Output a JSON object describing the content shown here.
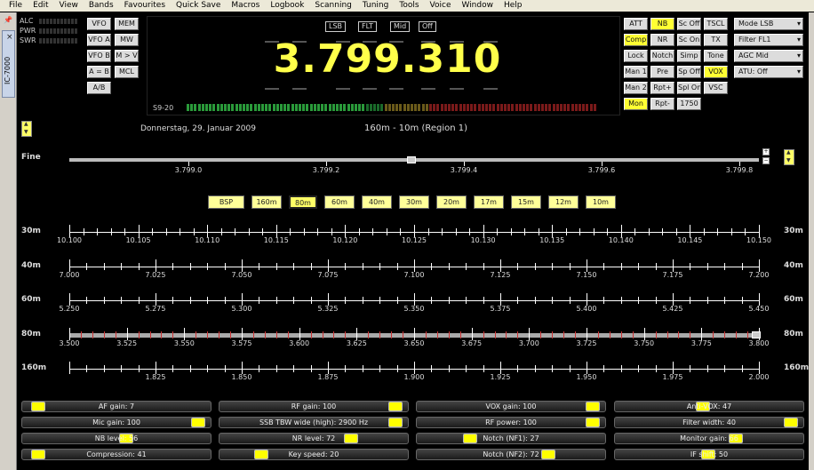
{
  "menu": [
    "File",
    "Edit",
    "View",
    "Bands",
    "Favourites",
    "Quick Save",
    "Macros",
    "Logbook",
    "Scanning",
    "Tuning",
    "Tools",
    "Voice",
    "Window",
    "Help"
  ],
  "side_tab": "IC-7000",
  "meters": [
    "ALC",
    "PWR",
    "SWR"
  ],
  "left_buttons": [
    [
      "VFO",
      "MEM"
    ],
    [
      "VFO A",
      "MW"
    ],
    [
      "VFO B",
      "M > V"
    ],
    [
      "A = B",
      "MCL"
    ],
    [
      "A/B"
    ]
  ],
  "display": {
    "chips": [
      "LSB",
      "FLT",
      "Mid",
      "Off"
    ],
    "frequency": "3.799.310",
    "smeter_label": "S9-20"
  },
  "func_buttons": [
    [
      {
        "t": "ATT",
        "on": false
      },
      {
        "t": "NB",
        "on": true
      },
      {
        "t": "Sc Off",
        "on": false
      },
      {
        "t": "TSCL",
        "on": false
      }
    ],
    [
      {
        "t": "Comp",
        "on": true
      },
      {
        "t": "NR",
        "on": false
      },
      {
        "t": "Sc On",
        "on": false
      },
      {
        "t": "TX",
        "on": false
      }
    ],
    [
      {
        "t": "Lock",
        "on": false
      },
      {
        "t": "Notch",
        "on": false
      },
      {
        "t": "Simp",
        "on": false
      },
      {
        "t": "Tone",
        "on": false
      }
    ],
    [
      {
        "t": "Man 1",
        "on": false
      },
      {
        "t": "Pre",
        "on": false
      },
      {
        "t": "Sp Off",
        "on": false
      },
      {
        "t": "VOX",
        "on": true
      }
    ],
    [
      {
        "t": "Man 2",
        "on": false
      },
      {
        "t": "Rpt+",
        "on": false
      },
      {
        "t": "Spl On",
        "on": false
      },
      {
        "t": "VSC",
        "on": false
      }
    ],
    [
      {
        "t": "Mon",
        "on": true
      },
      {
        "t": "Rpt-",
        "on": false
      },
      {
        "t": "1750",
        "on": false
      }
    ]
  ],
  "dropdowns": [
    "Mode LSB",
    "Filter FL1",
    "AGC Mid",
    "ATU: Off"
  ],
  "date": "Donnerstag, 29. Januar 2009",
  "region": "160m - 10m (Region 1)",
  "fine": {
    "label": "Fine",
    "ticks": [
      "3.799.0",
      "3.799.2",
      "3.799.4",
      "3.799.6",
      "3.799.8"
    ]
  },
  "bands": [
    "BSP",
    "160m",
    "80m",
    "60m",
    "40m",
    "30m",
    "20m",
    "17m",
    "15m",
    "12m",
    "10m"
  ],
  "selected_band": "80m",
  "scales": [
    {
      "label": "30m",
      "ticks": [
        "10.100",
        "10.105",
        "10.110",
        "10.115",
        "10.120",
        "10.125",
        "10.130",
        "10.135",
        "10.140",
        "10.145",
        "10.150"
      ]
    },
    {
      "label": "40m",
      "ticks": [
        "7.000",
        "7.025",
        "7.050",
        "7.075",
        "7.100",
        "7.125",
        "7.150",
        "7.175",
        "7.200"
      ]
    },
    {
      "label": "60m",
      "ticks": [
        "5.250",
        "5.275",
        "5.300",
        "5.325",
        "5.350",
        "5.375",
        "5.400",
        "5.425",
        "5.450"
      ]
    },
    {
      "label": "80m",
      "ticks": [
        "3.500",
        "3.525",
        "3.550",
        "3.575",
        "3.600",
        "3.625",
        "3.650",
        "3.675",
        "3.700",
        "3.725",
        "3.750",
        "3.775",
        "3.800"
      ]
    },
    {
      "label": "160m",
      "ticks": [
        "",
        "1.825",
        "1.850",
        "1.875",
        "1.900",
        "1.925",
        "1.950",
        "1.975",
        "2.000"
      ]
    }
  ],
  "sliders": [
    [
      {
        "label": "AF gain: 7",
        "v": 0.05
      },
      {
        "label": "RF gain: 100",
        "v": 0.98
      },
      {
        "label": "VOX gain: 100",
        "v": 0.98
      },
      {
        "label": "Anti-VOX: 47",
        "v": 0.47
      }
    ],
    [
      {
        "label": "Mic gain: 100",
        "v": 0.98
      },
      {
        "label": "SSB TBW wide (high): 2900 Hz",
        "v": 0.98
      },
      {
        "label": "RF power: 100",
        "v": 0.98
      },
      {
        "label": "Filter width: 40",
        "v": 0.98
      }
    ],
    [
      {
        "label": "NB level: 56",
        "v": 0.56
      },
      {
        "label": "NR level: 72",
        "v": 0.72
      },
      {
        "label": "Notch (NF1): 27",
        "v": 0.27
      },
      {
        "label": "Monitor gain: 66",
        "v": 0.66
      }
    ],
    [
      {
        "label": "Compression: 41",
        "v": 0.05
      },
      {
        "label": "Key speed: 20",
        "v": 0.2
      },
      {
        "label": "Notch (NF2): 72",
        "v": 0.72
      },
      {
        "label": "IF shift: 50",
        "v": 0.5
      }
    ]
  ]
}
